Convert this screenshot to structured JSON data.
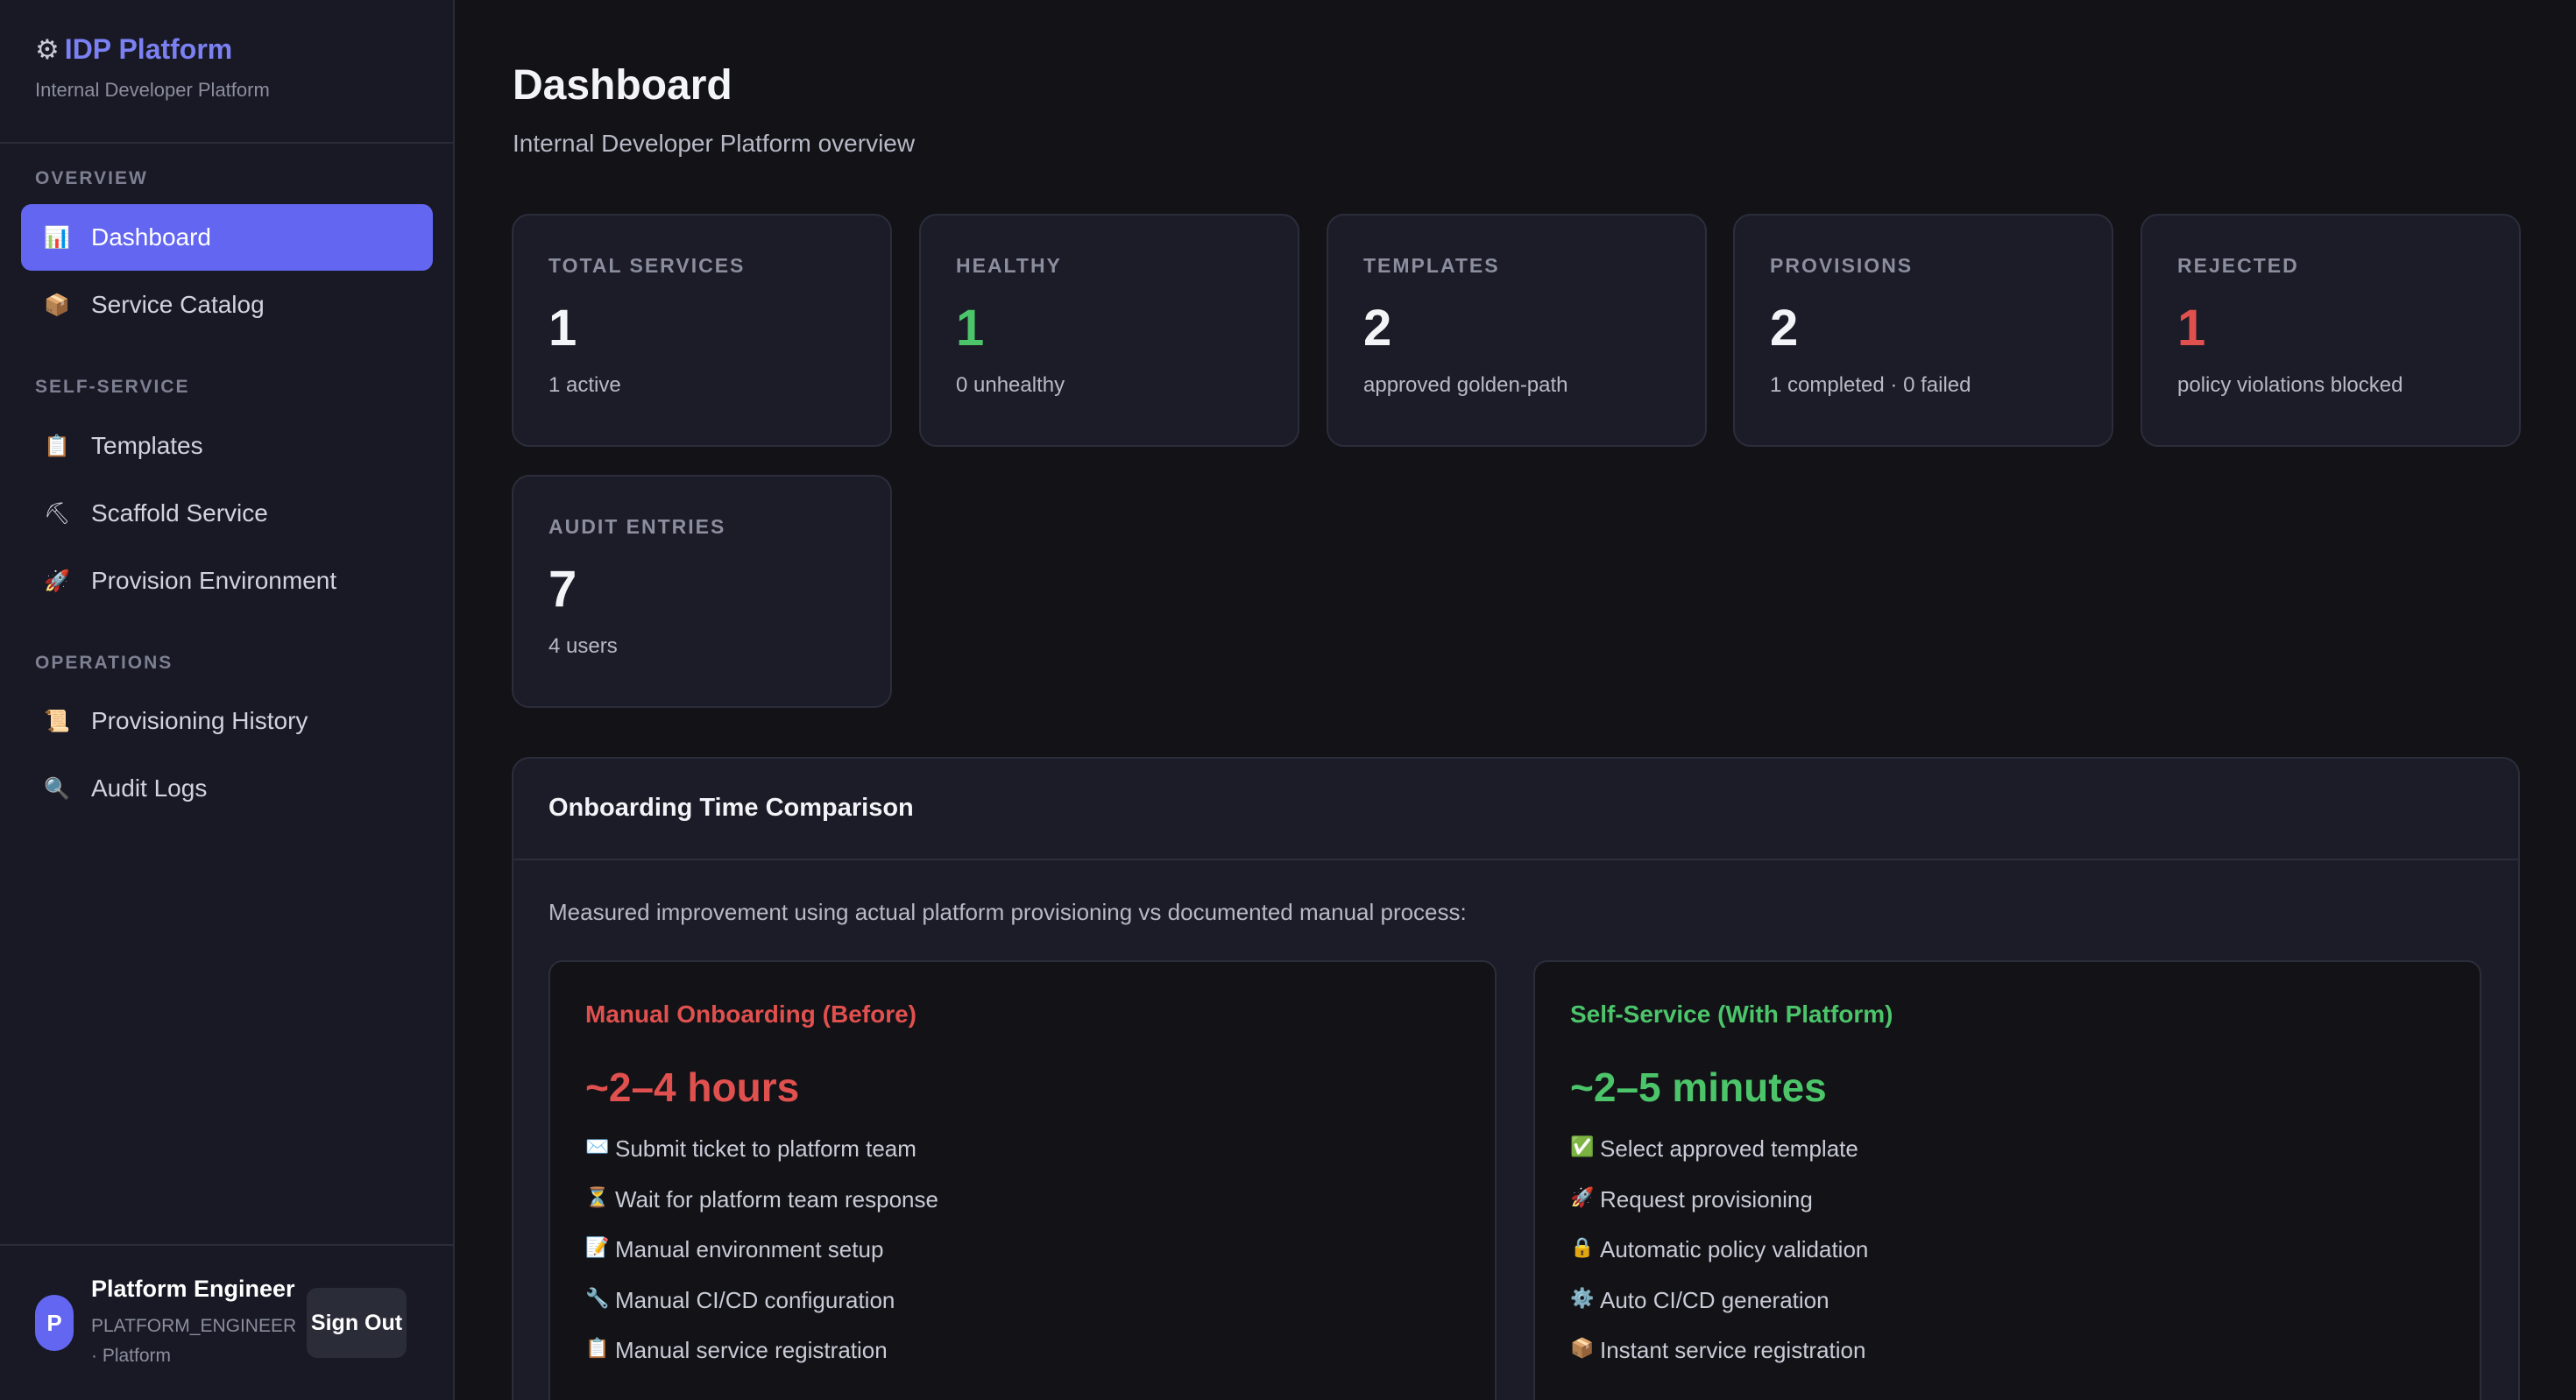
{
  "brand": {
    "icon": "gear-icon",
    "title": "IDP Platform",
    "subtitle": "Internal Developer Platform"
  },
  "nav": {
    "overview_label": "OVERVIEW",
    "self_service_label": "SELF-SERVICE",
    "operations_label": "OPERATIONS",
    "items": [
      {
        "label": "Dashboard",
        "icon": "bar-chart-icon",
        "glyph": "📊",
        "active": true
      },
      {
        "label": "Service Catalog",
        "icon": "package-icon",
        "glyph": "📦"
      },
      {
        "label": "Templates",
        "icon": "clipboard-icon",
        "glyph": "📋"
      },
      {
        "label": "Scaffold Service",
        "icon": "hammer-icon",
        "glyph": "⛏"
      },
      {
        "label": "Provision Environment",
        "icon": "rocket-icon",
        "glyph": "🚀"
      },
      {
        "label": "Provisioning History",
        "icon": "scroll-icon",
        "glyph": "📜"
      },
      {
        "label": "Audit Logs",
        "icon": "magnifier-icon",
        "glyph": "🔍"
      }
    ]
  },
  "user": {
    "initial": "P",
    "name": "Platform Engineer",
    "role": "PLATFORM_ENGINEER · Platform",
    "sign_out": "Sign Out"
  },
  "header": {
    "title": "Dashboard",
    "subtitle": "Internal Developer Platform overview"
  },
  "stats": [
    {
      "label": "TOTAL SERVICES",
      "value": "1",
      "sub": "1 active",
      "color": "#f3f4f8"
    },
    {
      "label": "HEALTHY",
      "value": "1",
      "sub": "0 unhealthy",
      "color": "#4cc46a"
    },
    {
      "label": "TEMPLATES",
      "value": "2",
      "sub": "approved golden-path",
      "color": "#f3f4f8"
    },
    {
      "label": "PROVISIONS",
      "value": "2",
      "sub": "1 completed · 0 failed",
      "color": "#f3f4f8"
    },
    {
      "label": "REJECTED",
      "value": "1",
      "sub": "policy violations blocked",
      "color": "#e0504e"
    },
    {
      "label": "AUDIT ENTRIES",
      "value": "7",
      "sub": "4 users",
      "color": "#f3f4f8"
    }
  ],
  "comparison": {
    "title": "Onboarding Time Comparison",
    "description": "Measured improvement using actual platform provisioning vs documented manual process:",
    "manual": {
      "title": "Manual Onboarding (Before)",
      "time": "~2–4 hours",
      "color": "#e0504e",
      "steps": [
        {
          "icon": "envelope-icon",
          "glyph": "✉️",
          "text": "Submit ticket to platform team"
        },
        {
          "icon": "hourglass-icon",
          "glyph": "⏳",
          "text": "Wait for platform team response"
        },
        {
          "icon": "memo-icon",
          "glyph": "📝",
          "text": "Manual environment setup"
        },
        {
          "icon": "wrench-icon",
          "glyph": "🔧",
          "text": "Manual CI/CD configuration"
        },
        {
          "icon": "clipboard-icon",
          "glyph": "📋",
          "text": "Manual service registration"
        }
      ]
    },
    "self_service": {
      "title": "Self-Service (With Platform)",
      "time": "~2–5 minutes",
      "color": "#4cc46a",
      "steps": [
        {
          "icon": "check-icon",
          "glyph": "✅",
          "text": "Select approved template"
        },
        {
          "icon": "rocket-icon",
          "glyph": "🚀",
          "text": "Request provisioning"
        },
        {
          "icon": "lock-icon",
          "glyph": "🔒",
          "text": "Automatic policy validation"
        },
        {
          "icon": "gear-icon",
          "glyph": "⚙️",
          "text": "Auto CI/CD generation"
        },
        {
          "icon": "package-icon",
          "glyph": "📦",
          "text": "Instant service registration"
        }
      ]
    }
  }
}
